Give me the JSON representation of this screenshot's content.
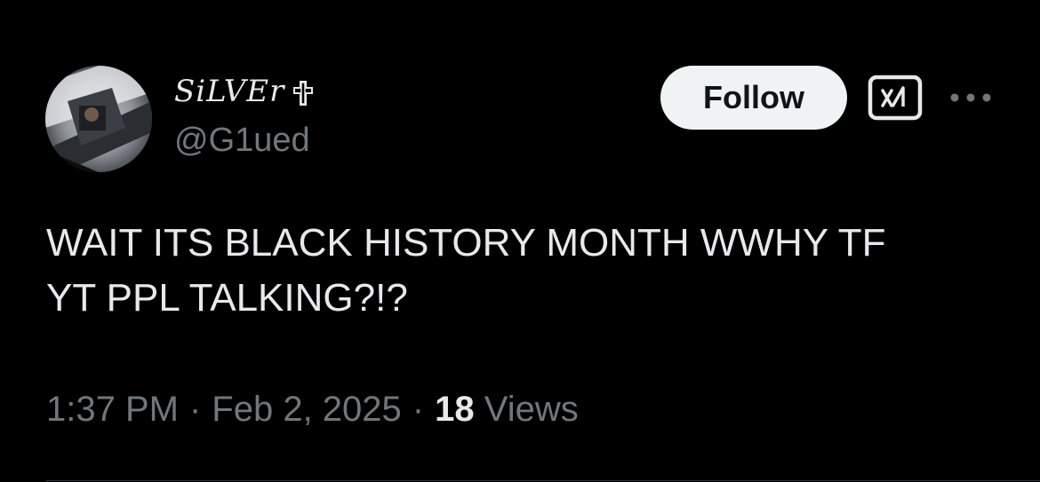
{
  "author": {
    "display_name": "SiLVEr",
    "handle": "@G1ued"
  },
  "actions": {
    "follow_label": "Follow",
    "grok_icon": "grok-icon",
    "more_icon": "more-icon"
  },
  "tweet": {
    "text": "WAIT ITS BLACK HISTORY MONTH WWHY TF\nYT PPL TALKING?!?",
    "time": "1:37 PM",
    "date": "Feb 2, 2025",
    "views_count": "18",
    "views_label": "Views"
  },
  "colors": {
    "background": "#000000",
    "primary_text": "#e7e9ea",
    "secondary_text": "#71767b",
    "follow_bg": "#eff3f4",
    "follow_text": "#0f1419"
  }
}
